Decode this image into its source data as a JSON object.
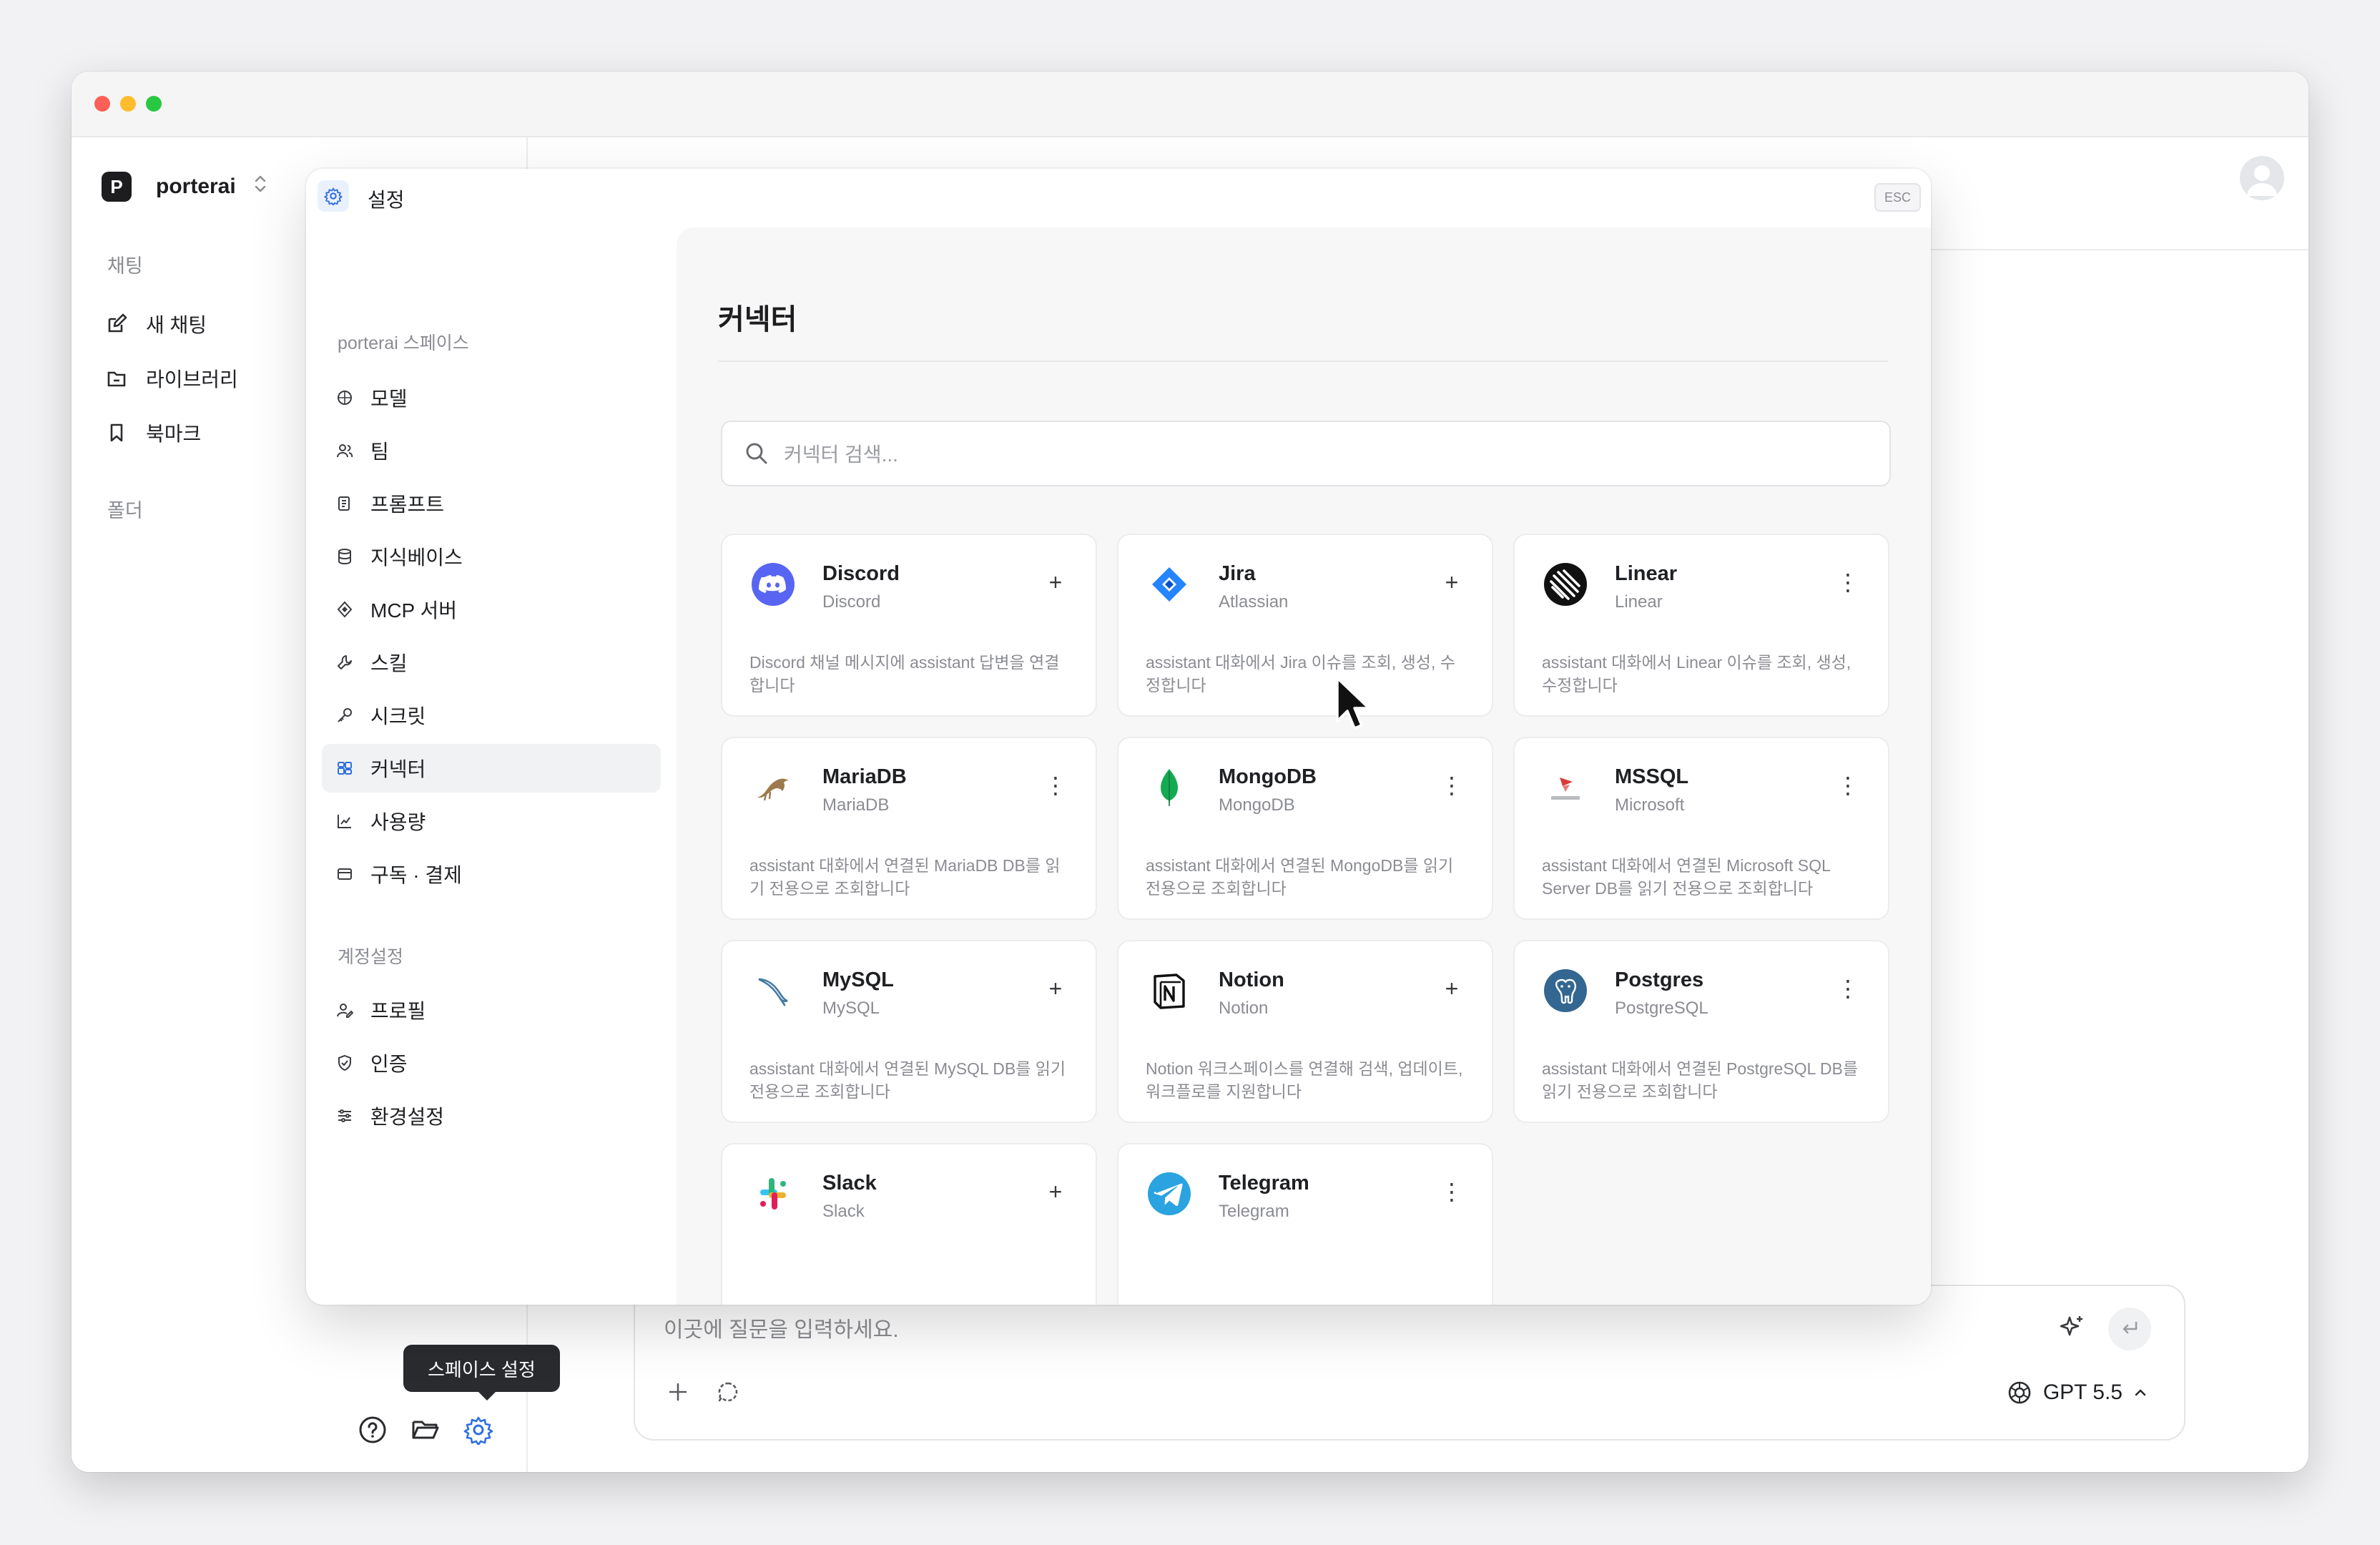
{
  "workspace": {
    "initial": "P",
    "name": "porterai"
  },
  "sidebar": {
    "chat_label": "채팅",
    "folder_chip": "폴더",
    "items": [
      {
        "label": "새 채팅",
        "icon": "edit-icon"
      },
      {
        "label": "라이브러리",
        "icon": "library-icon"
      },
      {
        "label": "북마크",
        "icon": "bookmark-icon"
      }
    ],
    "folders_label": "폴더",
    "tooltip": "스페이스 설정"
  },
  "composer": {
    "placeholder": "이곳에 질문을 입력하세요.",
    "model": "GPT 5.5"
  },
  "settings": {
    "title": "설정",
    "esc": "ESC",
    "space_section": "porterai 스페이스",
    "space_items": [
      {
        "label": "모델",
        "icon": "model-icon"
      },
      {
        "label": "팀",
        "icon": "team-icon"
      },
      {
        "label": "프롬프트",
        "icon": "prompt-icon"
      },
      {
        "label": "지식베이스",
        "icon": "database-icon"
      },
      {
        "label": "MCP 서버",
        "icon": "mcp-icon"
      },
      {
        "label": "스킬",
        "icon": "skill-icon"
      },
      {
        "label": "시크릿",
        "icon": "key-icon"
      },
      {
        "label": "커넥터",
        "icon": "connector-icon"
      },
      {
        "label": "사용량",
        "icon": "chart-icon"
      },
      {
        "label": "구독 · 결제",
        "icon": "card-icon"
      }
    ],
    "account_section": "계정설정",
    "account_items": [
      {
        "label": "프로필",
        "icon": "profile-icon"
      },
      {
        "label": "인증",
        "icon": "shield-icon"
      },
      {
        "label": "환경설정",
        "icon": "sliders-icon"
      }
    ],
    "active_item": "커넥터"
  },
  "connectors": {
    "title": "커넥터",
    "search_placeholder": "커넥터 검색...",
    "cards": [
      {
        "name": "Discord",
        "vendor": "Discord",
        "desc": "Discord 채널 메시지에 assistant 답변을 연결합니다",
        "action": "+",
        "icon": "discord-icon",
        "color": "#5865f2"
      },
      {
        "name": "Jira",
        "vendor": "Atlassian",
        "desc": "assistant 대화에서 Jira 이슈를 조회, 생성, 수정합니다",
        "action": "+",
        "icon": "jira-icon",
        "color": "#2684ff"
      },
      {
        "name": "Linear",
        "vendor": "Linear",
        "desc": "assistant 대화에서 Linear 이슈를 조회, 생성, 수정합니다",
        "action": "⋮",
        "icon": "linear-icon",
        "color": "#111111"
      },
      {
        "name": "MariaDB",
        "vendor": "MariaDB",
        "desc": "assistant 대화에서 연결된 MariaDB DB를 읽기 전용으로 조회합니다",
        "action": "⋮",
        "icon": "mariadb-icon",
        "color": "#9c7a4e"
      },
      {
        "name": "MongoDB",
        "vendor": "MongoDB",
        "desc": "assistant 대화에서 연결된 MongoDB를 읽기 전용으로 조회합니다",
        "action": "⋮",
        "icon": "mongodb-icon",
        "color": "#13aa52"
      },
      {
        "name": "MSSQL",
        "vendor": "Microsoft",
        "desc": "assistant 대화에서 연결된 Microsoft SQL Server DB를 읽기 전용으로 조회합니다",
        "action": "⋮",
        "icon": "mssql-icon",
        "color": "#d83b3b"
      },
      {
        "name": "MySQL",
        "vendor": "MySQL",
        "desc": "assistant 대화에서 연결된 MySQL DB를 읽기 전용으로 조회합니다",
        "action": "+",
        "icon": "mysql-icon",
        "color": "#4479a1"
      },
      {
        "name": "Notion",
        "vendor": "Notion",
        "desc": "Notion 워크스페이스를 연결해 검색, 업데이트, 워크플로를 지원합니다",
        "action": "+",
        "icon": "notion-icon",
        "color": "#111111"
      },
      {
        "name": "Postgres",
        "vendor": "PostgreSQL",
        "desc": "assistant 대화에서 연결된 PostgreSQL DB를 읽기 전용으로 조회합니다",
        "action": "⋮",
        "icon": "postgres-icon",
        "color": "#336791"
      },
      {
        "name": "Slack",
        "vendor": "Slack",
        "desc": "",
        "action": "+",
        "icon": "slack-icon",
        "color": "#e01e5a"
      },
      {
        "name": "Telegram",
        "vendor": "Telegram",
        "desc": "",
        "action": "⋮",
        "icon": "telegram-icon",
        "color": "#2aa3e0"
      }
    ]
  },
  "colors": {
    "accent": "#2f6fe0",
    "active_bg": "#f1f2f4",
    "tooltip_bg": "#2a2b2e"
  }
}
